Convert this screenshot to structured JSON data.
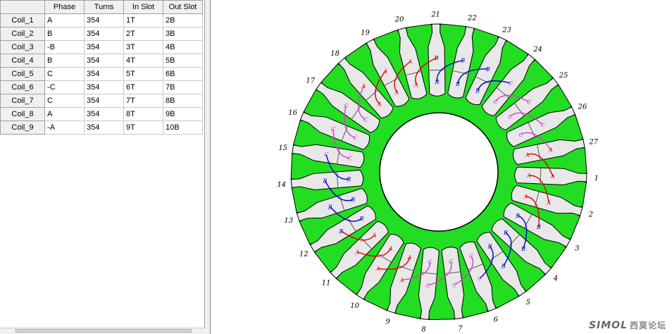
{
  "grid": {
    "columns": [
      "Phase",
      "Turns",
      "In Slot",
      "Out Slot"
    ],
    "rows": [
      {
        "name": "Coil_1",
        "phase": "A",
        "turns": "354",
        "in_slot": "1T",
        "out_slot": "2B"
      },
      {
        "name": "Coil_2",
        "phase": "B",
        "turns": "354",
        "in_slot": "2T",
        "out_slot": "3B"
      },
      {
        "name": "Coil_3",
        "phase": "-B",
        "turns": "354",
        "in_slot": "3T",
        "out_slot": "4B"
      },
      {
        "name": "Coil_4",
        "phase": "B",
        "turns": "354",
        "in_slot": "4T",
        "out_slot": "5B"
      },
      {
        "name": "Coil_5",
        "phase": "C",
        "turns": "354",
        "in_slot": "5T",
        "out_slot": "6B"
      },
      {
        "name": "Coil_6",
        "phase": "-C",
        "turns": "354",
        "in_slot": "6T",
        "out_slot": "7B"
      },
      {
        "name": "Coil_7",
        "phase": "C",
        "turns": "354",
        "in_slot": "7T",
        "out_slot": "8B"
      },
      {
        "name": "Coil_8",
        "phase": "A",
        "turns": "354",
        "in_slot": "8T",
        "out_slot": "9B"
      },
      {
        "name": "Coil_9",
        "phase": "-A",
        "turns": "354",
        "in_slot": "9T",
        "out_slot": "10B"
      }
    ]
  },
  "diagram": {
    "slot_count": 27,
    "slot_labels": [
      "1",
      "2",
      "3",
      "4",
      "5",
      "6",
      "7",
      "8",
      "9",
      "10",
      "11",
      "12",
      "13",
      "14",
      "15",
      "16",
      "17",
      "18",
      "19",
      "20",
      "21",
      "22",
      "23",
      "24",
      "25",
      "26",
      "27"
    ],
    "slot_phases": [
      "A",
      "A",
      "B",
      "B",
      "B",
      "C",
      "C",
      "C",
      "A",
      "A",
      "A",
      "B",
      "B",
      "B",
      "C",
      "C",
      "C",
      "A",
      "A",
      "A",
      "B",
      "B",
      "B",
      "C",
      "C",
      "C",
      "A"
    ],
    "phase_colors": {
      "A": "#e00000",
      "B": "#0000c8",
      "C": "#d040d0"
    },
    "stator_color": "#22dd22",
    "slot_fill_color": "#e8e8e8",
    "outline_color": "#000000"
  },
  "watermark": {
    "brand": "SIMOL",
    "site": "西莫论坛"
  }
}
